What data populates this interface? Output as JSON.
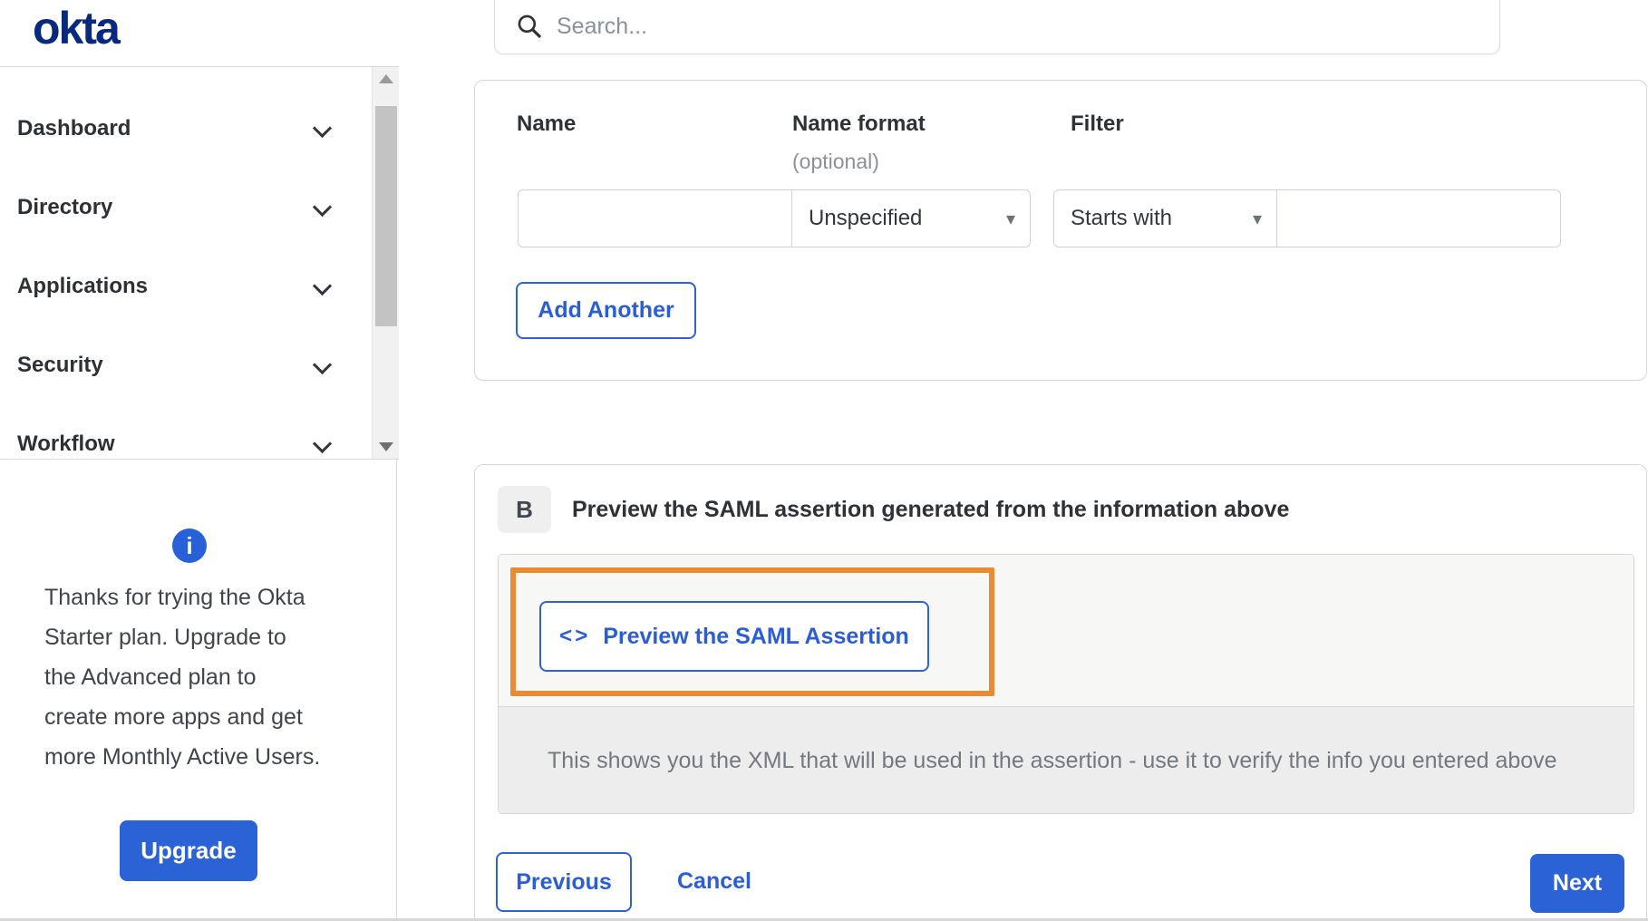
{
  "header": {
    "logo": "okta",
    "search_placeholder": "Search..."
  },
  "sidebar": {
    "nav_items": [
      {
        "label": "Dashboard"
      },
      {
        "label": "Directory"
      },
      {
        "label": "Applications"
      },
      {
        "label": "Security"
      },
      {
        "label": "Workflow"
      }
    ],
    "plan_notice_lines": [
      "Thanks for trying the Okta",
      "Starter plan. Upgrade to",
      "the Advanced plan to",
      "create more apps and get",
      "more Monthly Active Users."
    ],
    "info_icon_glyph": "i",
    "upgrade_label": "Upgrade"
  },
  "attribute_form": {
    "name_label": "Name",
    "name_format_label": "Name format",
    "name_format_optional": "(optional)",
    "filter_label": "Filter",
    "name_value": "",
    "name_format_value": "Unspecified",
    "filter_operator_value": "Starts with",
    "filter_value": "",
    "dropdown_caret_glyph": "▾",
    "add_another_label": "Add Another"
  },
  "preview_section": {
    "step_badge": "B",
    "title": "Preview the SAML assertion generated from the information above",
    "code_icon_glyph": "<>",
    "preview_button_label": "Preview the SAML Assertion",
    "description": "This shows you the XML that will be used in the assertion - use it to verify the info you entered above"
  },
  "wizard_footer": {
    "previous_label": "Previous",
    "cancel_label": "Cancel",
    "next_label": "Next"
  },
  "colors": {
    "accent_blue": "#2b63d6",
    "logo_navy": "#08297e",
    "highlight_orange": "#e78b35",
    "info_icon_blue": "#2760d8"
  }
}
